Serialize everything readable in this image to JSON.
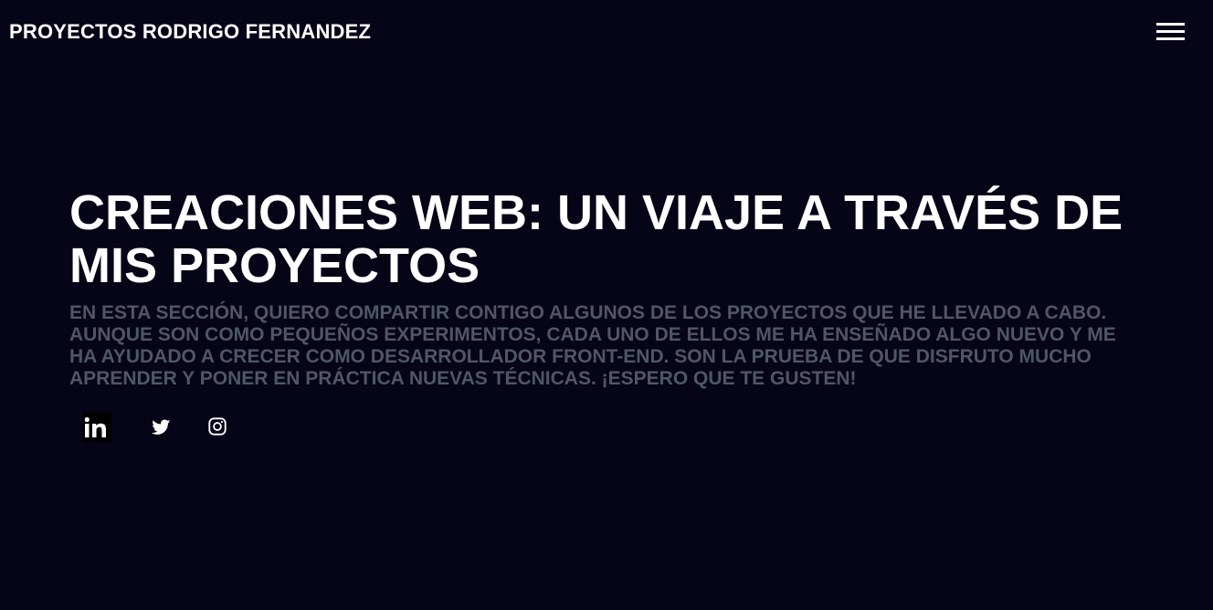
{
  "header": {
    "site_title": "PROYECTOS RODRIGO FERNANDEZ",
    "menu_icon": "hamburger-menu-icon"
  },
  "hero": {
    "title": "CREACIONES WEB: UN VIAJE A TRAVÉS DE MIS PROYECTOS",
    "description": "EN ESTA SECCIÓN, QUIERO COMPARTIR CONTIGO ALGUNOS DE LOS PROYECTOS QUE HE LLEVADO A CABO. AUNQUE SON COMO PEQUEÑOS EXPERIMENTOS, CADA UNO DE ELLOS ME HA ENSEÑADO ALGO NUEVO Y ME HA AYUDADO A CRECER COMO DESARROLLADOR FRONT-END. SON LA PRUEBA DE QUE DISFRUTO MUCHO APRENDER Y PONER EN PRÁCTICA NUEVAS TÉCNICAS. ¡ESPERO QUE TE GUSTEN!"
  },
  "social": [
    {
      "icon": "linkedin-icon"
    },
    {
      "icon": "twitter-icon"
    },
    {
      "icon": "instagram-icon"
    }
  ],
  "colors": {
    "background": "#060417",
    "title": "#ffffff",
    "description": "#4f5668"
  }
}
